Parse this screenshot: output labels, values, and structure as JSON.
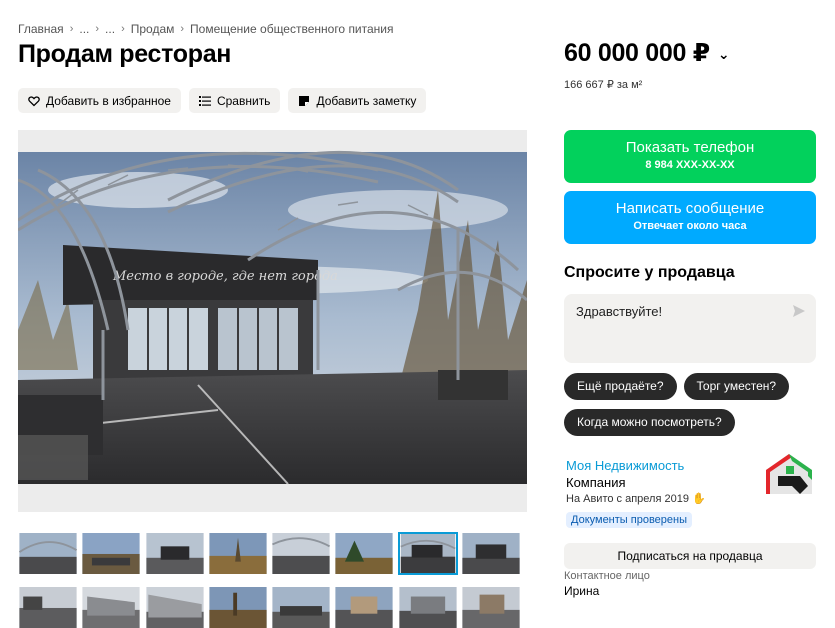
{
  "breadcrumb": {
    "items": [
      "Главная",
      "...",
      "...",
      "Продам",
      "Помещение общественного питания"
    ]
  },
  "title": "Продам ресторан",
  "actions": {
    "favorite": "Добавить в избранное",
    "compare": "Сравнить",
    "note": "Добавить заметку"
  },
  "photo": {
    "sign_text": "Место в городе, где нет города",
    "thumbnail_count": 16,
    "active_thumbnail": 7
  },
  "price": {
    "value": "60 000 000 ₽",
    "per_m2": "166 667 ₽ за м²"
  },
  "phone_button": {
    "label": "Показать телефон",
    "number": "8 984 XXX-XX-XX"
  },
  "message_button": {
    "label": "Написать сообщение",
    "sub": "Отвечает около часа"
  },
  "ask": {
    "title": "Спросите у продавца",
    "input_value": "Здравствуйте!",
    "chips": [
      "Ещё продаёте?",
      "Торг уместен?",
      "Когда можно посмотреть?"
    ]
  },
  "seller": {
    "name": "Моя Недвижимость",
    "type": "Компания",
    "since": "На Авито с апреля 2019",
    "badge": "Документы проверены",
    "subscribe": "Подписаться на продавца",
    "contact_label": "Контактное лицо",
    "contact_name": "Ирина"
  },
  "colors": {
    "phone_button": "#02d15c",
    "message_button": "#00aaff",
    "link": "#0a9bd6",
    "chip": "#292929"
  }
}
